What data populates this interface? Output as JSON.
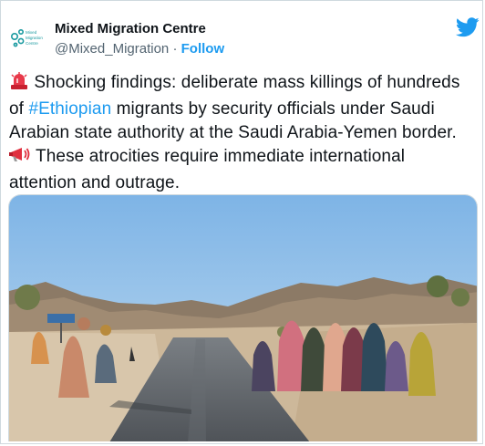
{
  "author": {
    "display_name": "Mixed Migration Centre",
    "handle": "@Mixed_Migration",
    "separator": "·",
    "follow_label": "Follow",
    "avatar_logo_text": [
      "Mixed",
      "Migration",
      "Centre"
    ],
    "avatar_icon": "mmc-logo-icon"
  },
  "platform_icon": "twitter-bird-icon",
  "tweet": {
    "siren_icon": "police-light-icon",
    "text_before_hashtag": "Shocking findings: deliberate mass killings of hundreds of ",
    "hashtag": "#Ethiopian",
    "text_after_hashtag": " migrants by security officials under Saudi Arabian state authority at the Saudi Arabia-Yemen border. ",
    "megaphone_icon": "megaphone-icon",
    "text_end": " These atrocities require immediate international attention and outrage."
  },
  "media": {
    "description_icon": "photo-media",
    "colors": {
      "sky": "#9fc5e8",
      "road": "#5d6166",
      "ground": "#c9b59a"
    }
  },
  "colors": {
    "link": "#1d9bf0",
    "text": "#0f1419",
    "muted": "#536471",
    "brand_teal": "#1a9aa0"
  }
}
